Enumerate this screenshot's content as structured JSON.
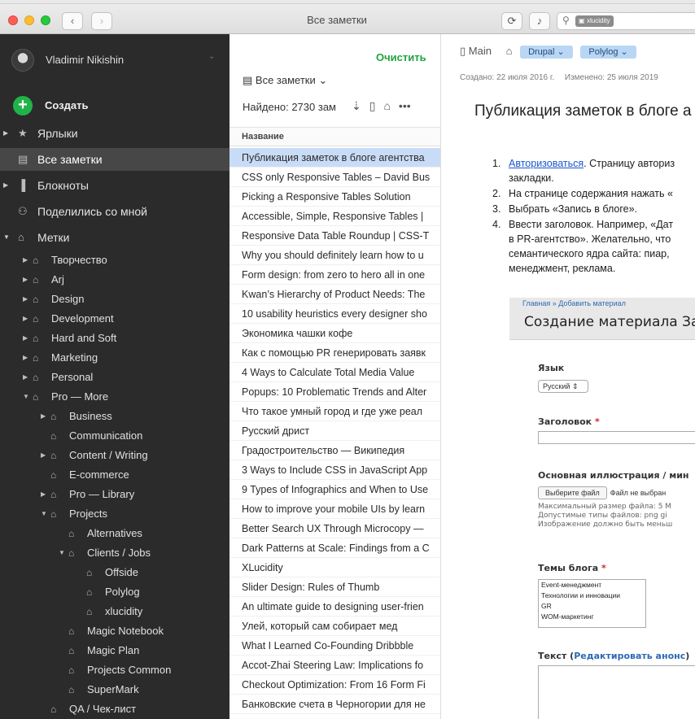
{
  "window": {
    "title": "Все заметки",
    "search_chip": "xlucidity"
  },
  "sidebar": {
    "account_name": "Vladimir Nikishin",
    "create_label": "Создать",
    "shortcuts_label": "Ярлыки",
    "all_notes_label": "Все заметки",
    "notebooks_label": "Блокноты",
    "shared_label": "Поделились со мной",
    "tags_label": "Метки",
    "tags": [
      {
        "label": "Творчество"
      },
      {
        "label": "Arj"
      },
      {
        "label": "Design"
      },
      {
        "label": "Development"
      },
      {
        "label": "Hard and Soft"
      },
      {
        "label": "Marketing"
      },
      {
        "label": "Personal"
      },
      {
        "label": "Pro — More"
      },
      {
        "label": "Business"
      },
      {
        "label": "Communication"
      },
      {
        "label": "Content / Writing"
      },
      {
        "label": "E-commerce"
      },
      {
        "label": "Pro — Library"
      },
      {
        "label": "Projects"
      },
      {
        "label": "Alternatives"
      },
      {
        "label": "Clients / Jobs"
      },
      {
        "label": "Offside"
      },
      {
        "label": "Polylog"
      },
      {
        "label": "xlucidity"
      },
      {
        "label": "Magic Notebook"
      },
      {
        "label": "Magic Plan"
      },
      {
        "label": "Projects Common"
      },
      {
        "label": "SuperMark"
      },
      {
        "label": "QA / Чек-лист"
      }
    ]
  },
  "list": {
    "clear_label": "Очистить",
    "scope_label": "Все заметки",
    "found_label": "Найдено: 2730 зам",
    "column_header": "Название",
    "notes": [
      "Публикация заметок в блоге агентства",
      "CSS only Responsive Tables – David Bus",
      "Picking a Responsive Tables Solution",
      "Accessible, Simple, Responsive Tables |",
      "Responsive Data Table Roundup | CSS-T",
      "Why you should definitely learn how to u",
      "Form design: from zero to hero all in one",
      "Kwan’s Hierarchy of Product Needs: The",
      "10 usability heuristics every designer sho",
      "Экономика чашки кофе",
      "Как с помощью PR генерировать заявк",
      "4 Ways to Calculate Total Media Value",
      "Popups: 10 Problematic Trends and Alter",
      "Что такое умный город и где уже реал",
      "Русский дрист",
      "Градостроительство — Википедия",
      "3 Ways to Include CSS in JavaScript App",
      "9 Types of Infographics and When to Use",
      "How to improve your mobile UIs by learn",
      "Better Search UX Through Microcopy —",
      "Dark Patterns at Scale: Findings from a C",
      "XLucidity",
      "Slider Design: Rules of Thumb",
      "An ultimate guide to designing user-frien",
      "Улей, который сам собирает мед",
      "What I Learned Co-Founding Dribbble",
      "Accot-Zhai Steering Law: Implications fo",
      "Checkout Optimization: From 16 Form Fi",
      "Банковские счета в Черногории для не"
    ]
  },
  "note": {
    "notebook": "Main",
    "tags": [
      "Drupal",
      "Polylog"
    ],
    "created": "Создано: 22 июля 2016 г.",
    "modified": "Изменено: 25 июля 2019",
    "title": "Публикация заметок в блоге а",
    "steps": [
      {
        "num": "1.",
        "link": "Авторизоваться",
        "text": ". Страницу авториз",
        "text2": "закладки."
      },
      {
        "num": "2.",
        "text": "На странице содержания нажать «"
      },
      {
        "num": "3.",
        "text": "Выбрать «Запись в блоге»."
      },
      {
        "num": "4.",
        "text": "Ввести заголовок. Например, «Дат",
        "text2": "в PR-агентство». Желательно, что",
        "text3": "семантического ядра сайта: пиар,",
        "text4": "менеджмент, реклама."
      }
    ],
    "screenshot": {
      "crumb": "Главная » Добавить материал",
      "title": "Создание материала Зап",
      "lang_label": "Язык",
      "lang_value": "Русский ⇕",
      "heading_label": "Заголовок",
      "required_mark": "*",
      "image_label": "Основная иллюстрация / мин",
      "file_button": "Выберите файл",
      "file_status": "Файл не выбран",
      "hint1": "Максимальный размер файла: 5 М",
      "hint2": "Допустимые типы файлов: png gi",
      "hint3": "Изображение должно быть меньш",
      "topics_label": "Темы блога",
      "topics": [
        "Event-менеджмент",
        "Технологии и инновации",
        "GR",
        "WOM-маркетинг"
      ],
      "text_label": "Текст (",
      "text_link": "Редактировать анонс",
      "text_close": ")"
    }
  }
}
